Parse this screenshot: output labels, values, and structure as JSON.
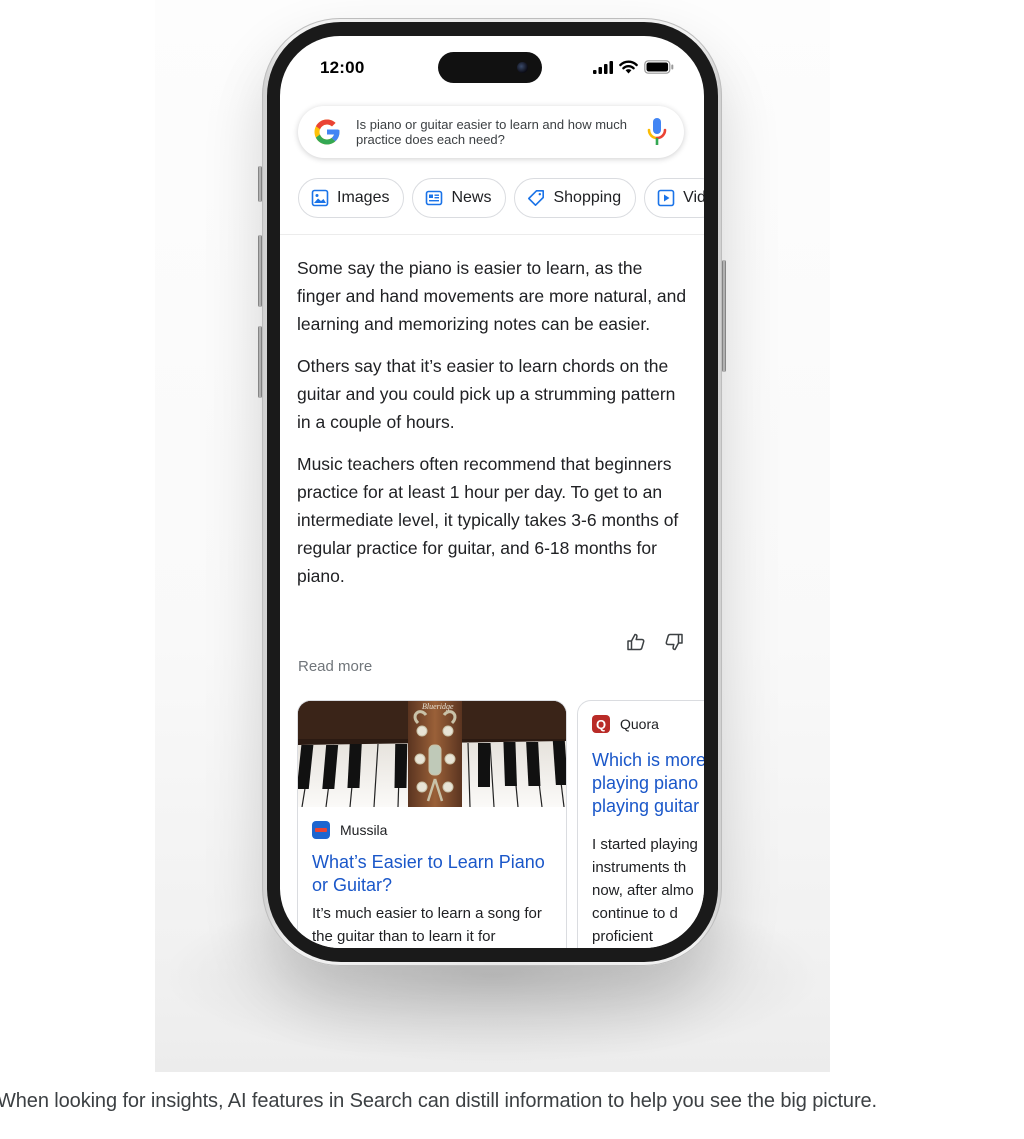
{
  "status_bar": {
    "time": "12:00"
  },
  "search": {
    "query": "Is piano or guitar easier to learn and how much practice does each need?",
    "icons": [
      "google-logo",
      "mic-icon"
    ]
  },
  "chips": [
    {
      "label": "Images",
      "icon": "image-icon"
    },
    {
      "label": "News",
      "icon": "news-icon"
    },
    {
      "label": "Shopping",
      "icon": "tag-icon"
    },
    {
      "label": "Videos",
      "visible_label": "Vid",
      "icon": "play-icon"
    }
  ],
  "overview": {
    "paragraphs": [
      "Some say the piano is easier to learn, as the finger and hand movements are more natural, and learning and memorizing notes can be easier.",
      "Others say that it’s easier to learn chords on the guitar and you could pick up a strumming pattern in a couple of hours.",
      "Music teachers often recommend that beginners practice for at least 1 hour per day. To get to an intermediate level, it typically takes 3-6 months of regular practice for guitar, and 6-18 months for piano."
    ],
    "feedback": [
      "thumbs-up-icon",
      "thumbs-down-icon"
    ],
    "read_more": "Read more"
  },
  "cards": [
    {
      "source": "Mussila",
      "title": "What’s Easier to Learn Piano or Guitar?",
      "snippet": "It’s much easier to learn a song for the guitar than to learn it for",
      "image": "guitar headstock on piano keys",
      "favicon_color": "#1e66d0"
    },
    {
      "source": "Quora",
      "favicon_letter": "Q",
      "title": "Which is more difficult, playing piano or playing guitar",
      "visible_title": [
        "Which is more",
        "playing piano",
        "playing guitar"
      ],
      "snippet_lines": [
        "I started playing",
        "instruments th",
        "now, after almo",
        "continue to d",
        "proficient"
      ],
      "favicon_color": "#b92b27"
    }
  ],
  "caption": "When looking for insights, AI features in Search can distill information to help you see the big picture.",
  "colors": {
    "link_blue": "#1a57c9",
    "google_blue": "#4285f4",
    "google_red": "#ea4335",
    "google_yellow": "#fbbc05",
    "google_green": "#34a853",
    "quora_red": "#b92b27"
  }
}
